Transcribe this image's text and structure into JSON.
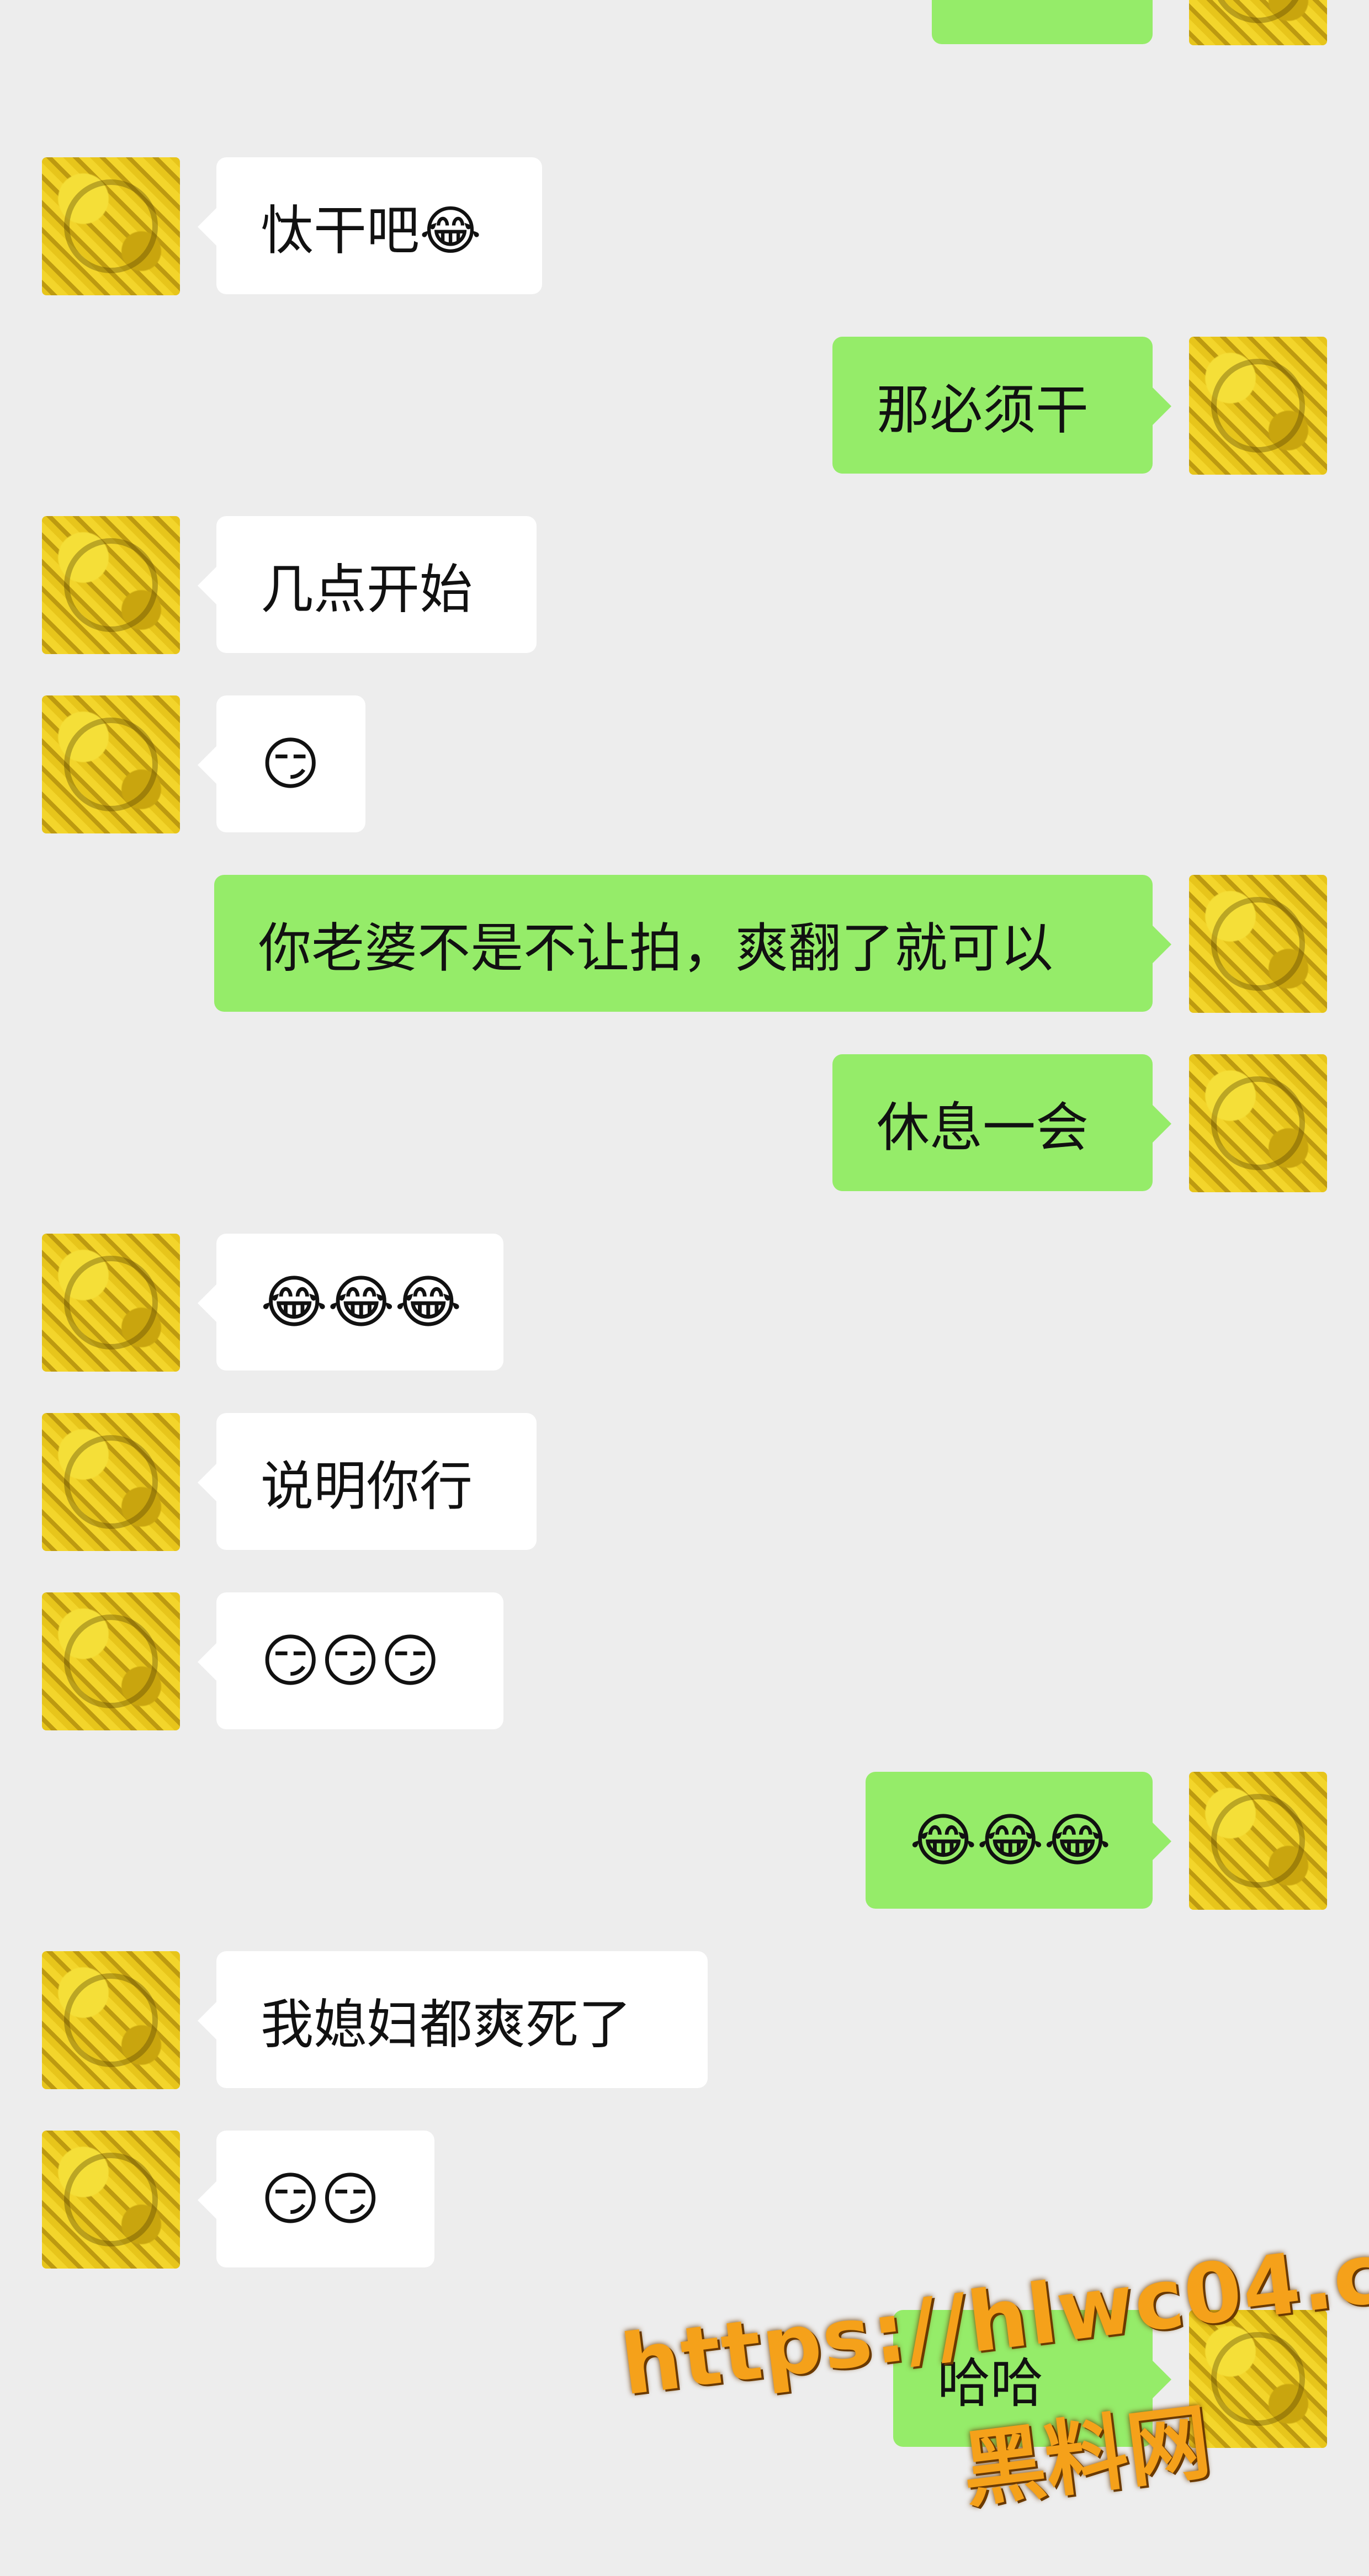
{
  "messages": [
    {
      "side": "right",
      "text": "😂😂"
    },
    {
      "side": "left",
      "text": "忲干吧😂"
    },
    {
      "side": "right",
      "text": "那必须干"
    },
    {
      "side": "left",
      "text": "几点开始"
    },
    {
      "side": "left",
      "text": "😏"
    },
    {
      "side": "right",
      "text": "你老婆不是不让拍，爽翻了就可以"
    },
    {
      "side": "right",
      "text": "休息一会"
    },
    {
      "side": "left",
      "text": "😂😂😂"
    },
    {
      "side": "left",
      "text": "说明你行"
    },
    {
      "side": "left",
      "text": "😏😏😏"
    },
    {
      "side": "right",
      "text": "😂😂😂"
    },
    {
      "side": "left",
      "text": "我媳妇都爽死了"
    },
    {
      "side": "left",
      "text": "😏😏"
    },
    {
      "side": "right",
      "text": "哈哈"
    }
  ],
  "watermark": {
    "url": "https://hlwc04.com",
    "site": "黑料网"
  },
  "colors": {
    "background": "#ededed",
    "incoming_bubble": "#ffffff",
    "outgoing_bubble": "#95ec69",
    "watermark": "#f5a11a"
  }
}
